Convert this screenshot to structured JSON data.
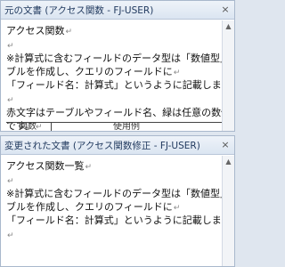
{
  "top_pane": {
    "title": "元の文書 (アクセス関数 - FJ-USER)",
    "lines": [
      "アクセス関数",
      "",
      "※計算式に含むフィールドのデータ型は「数値型」でテー",
      "ブルを作成し、クエリのフィールドに",
      "「フィールド名：計算式」というように記載します。",
      "",
      "赤文字はテーブルやフィールド名、緑は任意の数値（記号",
      "です。"
    ],
    "table_header": [
      "関数",
      "使用例"
    ]
  },
  "bottom_pane": {
    "title": "変更された文書 (アクセス関数修正 - FJ-USER)",
    "lines": [
      "アクセス関数一覧",
      "",
      "※計算式に含むフィールドのデータ型は「数値型」でテー",
      "ブルを作成し、クエリのフィールドに",
      "「フィールド名：計算式」というように記載します。",
      ""
    ]
  },
  "icons": {
    "close": "close-icon",
    "paragraph_mark": "paragraph-mark-icon"
  }
}
